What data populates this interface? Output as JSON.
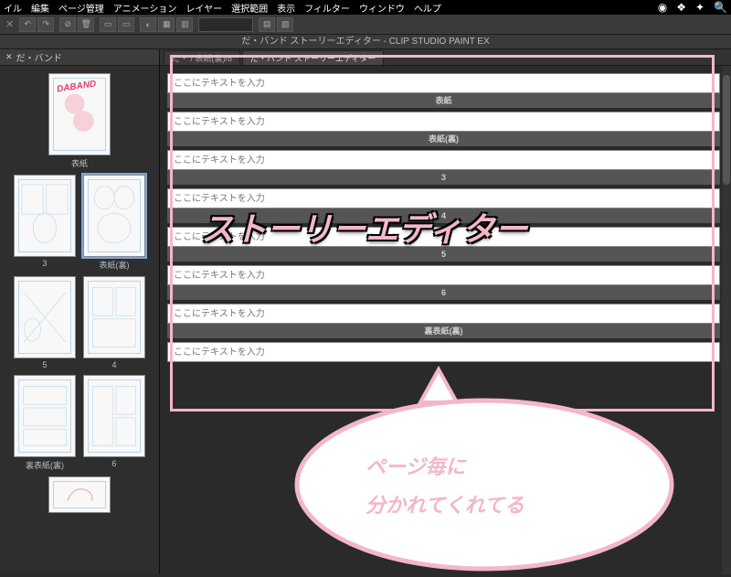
{
  "menubar": {
    "items": [
      "イル",
      "編集",
      "ページ管理",
      "アニメーション",
      "レイヤー",
      "選択範囲",
      "表示",
      "フィルター",
      "ウィンドウ",
      "ヘルプ"
    ]
  },
  "window_title": "だ・バンド ストーリーエディター - CLIP STUDIO PAINT EX",
  "sidebar": {
    "tab_label": "だ・バンド",
    "thumbs": [
      {
        "rows": [
          {
            "label": "表紙",
            "cover": true,
            "title": "DABAND"
          }
        ]
      },
      {
        "rows": [
          {
            "label": "3"
          },
          {
            "label": "表紙(裏)",
            "selected": true
          }
        ]
      },
      {
        "rows": [
          {
            "label": "5"
          },
          {
            "label": "4"
          }
        ]
      },
      {
        "rows": [
          {
            "label": "裏表紙(裏)"
          },
          {
            "label": "6"
          }
        ]
      },
      {
        "rows": [
          {
            "label": ""
          }
        ]
      }
    ]
  },
  "tabs": [
    {
      "label": "だ・ / 表紙(裏)/8",
      "active": false
    },
    {
      "label": "だ・バンド ストーリーエディター",
      "active": true
    }
  ],
  "editor": {
    "placeholder": "ここにテキストを入力",
    "pages": [
      {
        "label": "表紙"
      },
      {
        "label": "表紙(裏)"
      },
      {
        "label": "3"
      },
      {
        "label": "4"
      },
      {
        "label": "5"
      },
      {
        "label": "6"
      },
      {
        "label": "裏表紙(裏)"
      },
      {
        "label": ""
      }
    ]
  },
  "annotations": {
    "title": "ストーリーエディター",
    "bubble_line1": "ページ毎に",
    "bubble_line2": "分かれてくれてる"
  }
}
